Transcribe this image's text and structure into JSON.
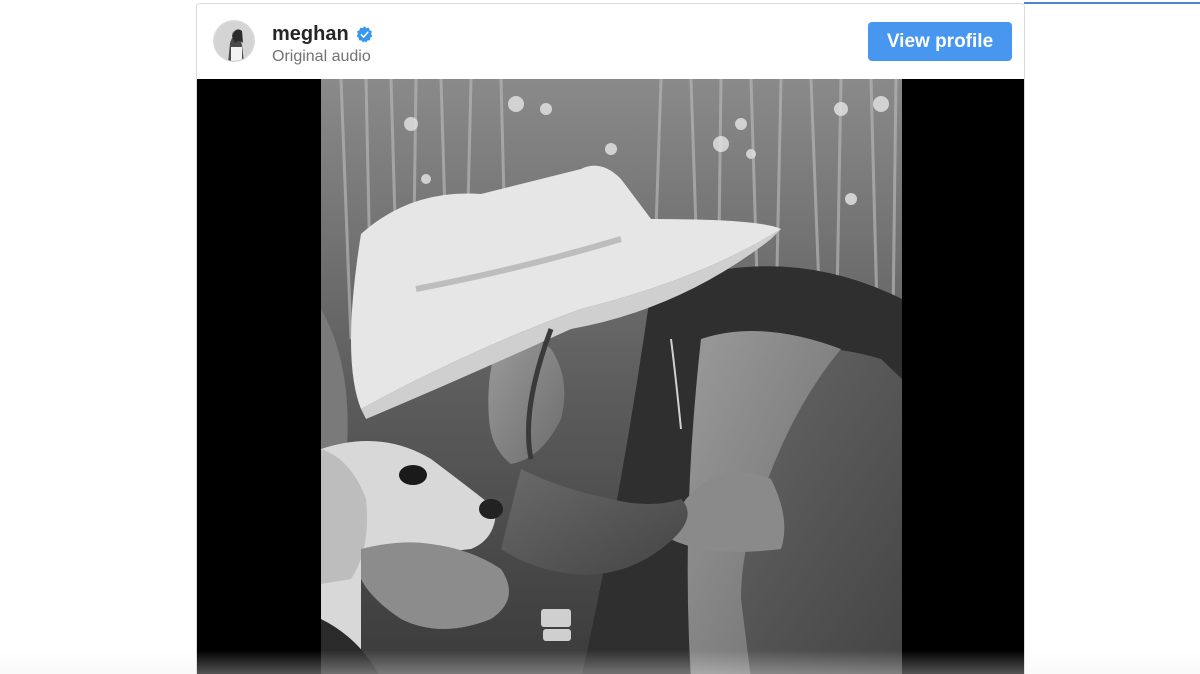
{
  "post": {
    "username": "meghan",
    "verified": true,
    "subtitle": "Original audio",
    "view_profile_label": "View profile"
  },
  "media": {
    "description_icon": "photo-icon"
  },
  "colors": {
    "button": "#4796f0",
    "verified_badge": "#3897f0",
    "username": "#262626",
    "subtitle": "#737373",
    "media_background": "#000000"
  },
  "icons": {
    "verified": "verified-badge-icon"
  }
}
